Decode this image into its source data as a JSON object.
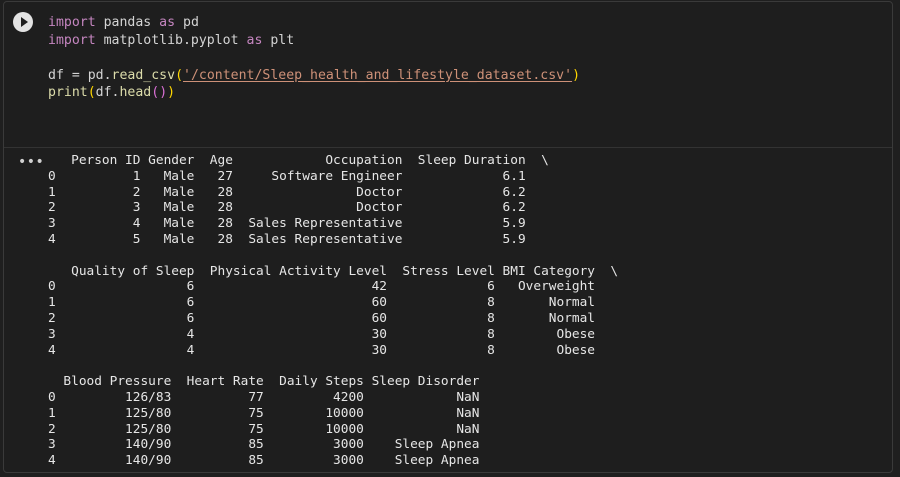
{
  "code_cell": {
    "lines": [
      "import pandas as pd",
      "import matplotlib.pyplot as plt",
      "",
      "df = pd.read_csv('/content/Sleep_health_and_lifestyle_dataset.csv')",
      "print(df.head())"
    ],
    "run_icon": "play-circle-icon"
  },
  "output_menu_icon": "ellipsis-icon",
  "output": {
    "text": "   Person ID Gender  Age            Occupation  Sleep Duration  \\\n0          1   Male   27     Software Engineer             6.1   \n1          2   Male   28                Doctor             6.2   \n2          3   Male   28                Doctor             6.2   \n3          4   Male   28  Sales Representative             5.9   \n4          5   Male   28  Sales Representative             5.9   \n\n   Quality of Sleep  Physical Activity Level  Stress Level BMI Category  \\\n0                 6                       42             6   Overweight   \n1                 6                       60             8       Normal   \n2                 6                       60             8       Normal   \n3                 4                       30             8        Obese   \n4                 4                       30             8        Obese   \n\n  Blood Pressure  Heart Rate  Daily Steps Sleep Disorder  \n0         126/83          77         4200            NaN  \n1         125/80          75        10000            NaN  \n2         125/80          75        10000            NaN  \n3         140/90          85         3000    Sleep Apnea  \n4         140/90          85         3000    Sleep Apnea  "
  },
  "colors": {
    "background": "#1e1e1e",
    "keyword": "#c586c0",
    "function": "#dcdcaa",
    "string": "#ce9178",
    "bracket_outer": "#ffd700",
    "bracket_inner": "#da70d6",
    "text": "#d4d4d4"
  }
}
